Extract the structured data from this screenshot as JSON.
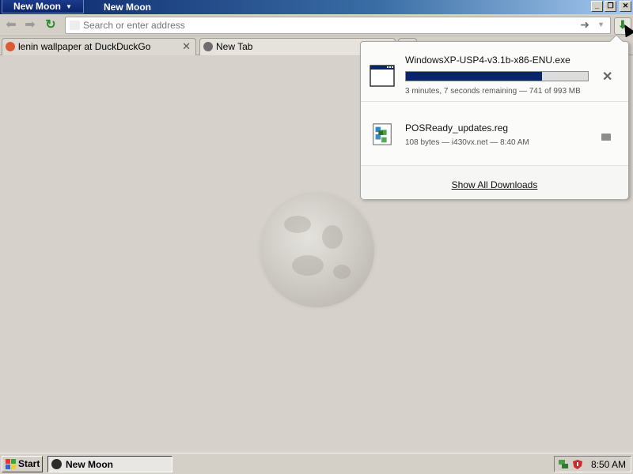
{
  "window": {
    "app_menu_label": "New Moon",
    "title": "New Moon"
  },
  "toolbar": {
    "url_placeholder": "Search or enter address",
    "url_value": ""
  },
  "tabs": [
    {
      "label": "lenin wallpaper at DuckDuckGo",
      "favicon": "duckduckgo-icon",
      "selected": false
    },
    {
      "label": "New Tab",
      "favicon": "globe-icon",
      "selected": true
    }
  ],
  "downloads": {
    "items": [
      {
        "filename": "WindowsXP-USP4-v3.1b-x86-ENU.exe",
        "status": "3 minutes, 7 seconds remaining — 741 of 993 MB",
        "progress_fraction": 0.746,
        "icon": "application-window-icon",
        "action": "cancel"
      },
      {
        "filename": "POSReady_updates.reg",
        "status": "108 bytes — i430vx.net — 8:40 AM",
        "icon": "registry-file-icon",
        "action": "open-folder"
      }
    ],
    "show_all_label": "Show All Downloads"
  },
  "taskbar": {
    "start_label": "Start",
    "task_label": "New Moon",
    "clock": "8:50 AM"
  },
  "colors": {
    "titlebar_start": "#0a246a",
    "titlebar_end": "#a6caf0",
    "progress_fill": "#0a246a",
    "face": "#d4d0c8"
  }
}
